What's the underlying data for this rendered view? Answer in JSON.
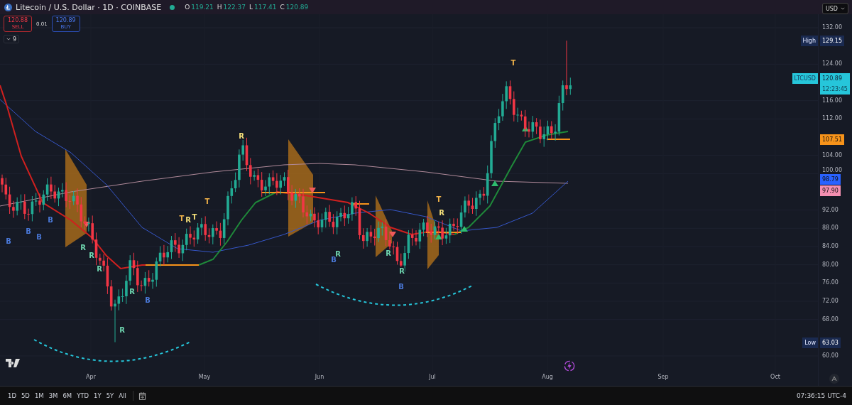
{
  "header": {
    "symbol": "Litecoin / U.S. Dollar · 1D · COINBASE",
    "market_open": true,
    "ohlc": [
      {
        "label": "O",
        "value": "119.21"
      },
      {
        "label": "H",
        "value": "122.37"
      },
      {
        "label": "L",
        "value": "117.41"
      },
      {
        "label": "C",
        "value": "120.89"
      }
    ]
  },
  "currency": {
    "value": "USD"
  },
  "trade": {
    "sell": {
      "price": "120.88",
      "label": "SELL"
    },
    "spread": "0.01",
    "buy": {
      "price": "120.89",
      "label": "BUY"
    }
  },
  "indicators_toggle": {
    "count": "9"
  },
  "price_axis": {
    "ticks": [
      "132.00",
      "124.00",
      "116.00",
      "112.00",
      "104.00",
      "100.00",
      "92.00",
      "88.00",
      "84.00",
      "80.00",
      "76.00",
      "72.00",
      "68.00",
      "60.00"
    ]
  },
  "price_badges": [
    {
      "kind": "extreme",
      "label": "High",
      "value": "129.15"
    },
    {
      "kind": "current",
      "label": "LTCUSD",
      "value": "120.89",
      "countdown": "12:23:45"
    },
    {
      "kind": "level",
      "value": "107.51",
      "color": "#f7931a"
    },
    {
      "kind": "level",
      "value": "98.79",
      "color": "#2962ff"
    },
    {
      "kind": "level",
      "value": "97.90",
      "color": "#f48fb1"
    },
    {
      "kind": "extreme",
      "label": "Low",
      "value": "63.03"
    }
  ],
  "time_axis": [
    "Apr",
    "May",
    "Jun",
    "Jul",
    "Aug",
    "Sep",
    "Oct"
  ],
  "signals": [
    {
      "text": "B",
      "color": "#4a78d8"
    },
    {
      "text": "B",
      "color": "#4a78d8"
    },
    {
      "text": "B",
      "color": "#4a78d8"
    },
    {
      "text": "B",
      "color": "#4a78d8"
    },
    {
      "text": "R",
      "color": "#6fd6b0"
    },
    {
      "text": "R",
      "color": "#6fd6b0"
    },
    {
      "text": "R",
      "color": "#6fd6b0"
    },
    {
      "text": "R",
      "color": "#6fd6b0"
    },
    {
      "text": "R",
      "color": "#6fd6b0"
    },
    {
      "text": "B",
      "color": "#4a78d8"
    },
    {
      "text": "T",
      "color": "#f0b24a"
    },
    {
      "text": "R",
      "color": "#f5e07a"
    },
    {
      "text": "T",
      "color": "#f5e07a"
    },
    {
      "text": "T",
      "color": "#f0b24a"
    },
    {
      "text": "R",
      "color": "#f5e07a"
    },
    {
      "text": "B",
      "color": "#4a78d8"
    },
    {
      "text": "R",
      "color": "#6fd6b0"
    },
    {
      "text": "R",
      "color": "#6fd6b0"
    },
    {
      "text": "B",
      "color": "#4a78d8"
    },
    {
      "text": "R",
      "color": "#6fd6b0"
    },
    {
      "text": "T",
      "color": "#f0b24a"
    },
    {
      "text": "R",
      "color": "#f5e07a"
    },
    {
      "text": "T",
      "color": "#f0b24a"
    }
  ],
  "range_buttons": [
    "1D",
    "5D",
    "1M",
    "3M",
    "6M",
    "YTD",
    "1Y",
    "5Y",
    "All"
  ],
  "clock": "07:36:15 UTC-4"
}
